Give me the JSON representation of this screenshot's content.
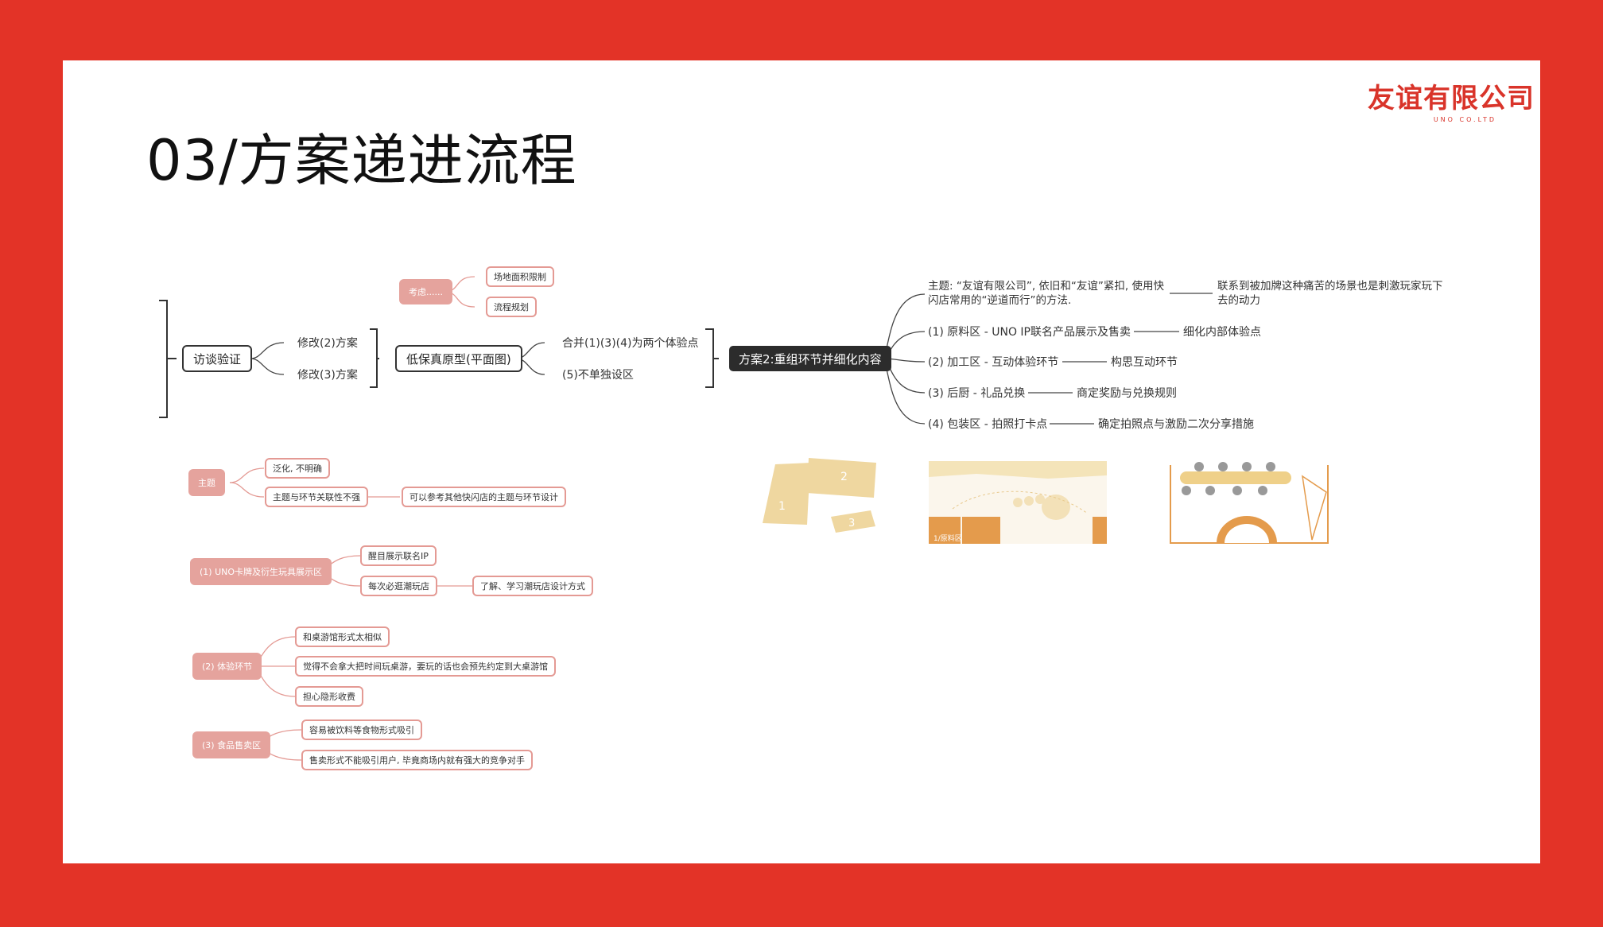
{
  "slide": {
    "title": "03/方案递进流程",
    "logo": {
      "text": "友谊有限公司",
      "subtext": "UNO CO.LTD"
    }
  },
  "colors": {
    "frame": "#e33327",
    "pink": "#e5a39d",
    "pink_border": "#e49a94",
    "dark": "#2c2c2c",
    "floor_plan_tan": "#efd7a0",
    "floor_plan_orange": "#e49b4c"
  },
  "flow": {
    "interview": "访谈验证",
    "revise2": "修改(2)方案",
    "revise3": "修改(3)方案",
    "lofi": "低保真原型(平面图)",
    "consider": "考虑......",
    "site_limit": "场地面积限制",
    "process_plan": "流程规划",
    "merge": "合并(1)(3)(4)为两个体验点",
    "no_separate": "(5)不单独设区",
    "scheme2": "方案2:重组环节并细化内容"
  },
  "scheme2_branches": [
    {
      "label": "主题: “友谊有限公司”, 依旧和“友谊”紧扣, 使用快\n闪店常用的“逆道而行”的方法.",
      "detail": "联系到被加牌这种痛苦的场景也是刺激玩家玩下\n去的动力"
    },
    {
      "label": "(1) 原料区 - UNO IP联名产品展示及售卖",
      "detail": "细化内部体验点"
    },
    {
      "label": "(2) 加工区 - 互动体验环节",
      "detail": "构思互动环节"
    },
    {
      "label": "(3) 后厨 - 礼品兑换",
      "detail": "商定奖励与兑换规则"
    },
    {
      "label": "(4) 包装区 - 拍照打卡点",
      "detail": "确定拍照点与激励二次分享措施"
    }
  ],
  "feedback": {
    "theme": {
      "label": "主题",
      "items": [
        "泛化, 不明确",
        "主题与环节关联性不强"
      ],
      "followup": "可以参考其他快闪店的主题与环节设计"
    },
    "zone1": {
      "label": "(1) UNO卡牌及衍生玩具展示区",
      "items": [
        "醒目展示联名IP",
        "每次必逛潮玩店"
      ],
      "followup": "了解、学习潮玩店设计方式"
    },
    "zone2": {
      "label": "(2) 体验环节",
      "items": [
        "和桌游馆形式太相似",
        "觉得不会拿大把时间玩桌游，要玩的话也会预先约定到大桌游馆",
        "担心隐形收费"
      ]
    },
    "zone3": {
      "label": "(3) 食品售卖区",
      "items": [
        "容易被饮料等食物形式吸引",
        "售卖形式不能吸引用户, 毕竟商场内就有强大的竞争对手"
      ]
    }
  },
  "thumbnails": {
    "blocks": [
      "1",
      "2",
      "3"
    ],
    "plan1_label": "1/原料区"
  }
}
